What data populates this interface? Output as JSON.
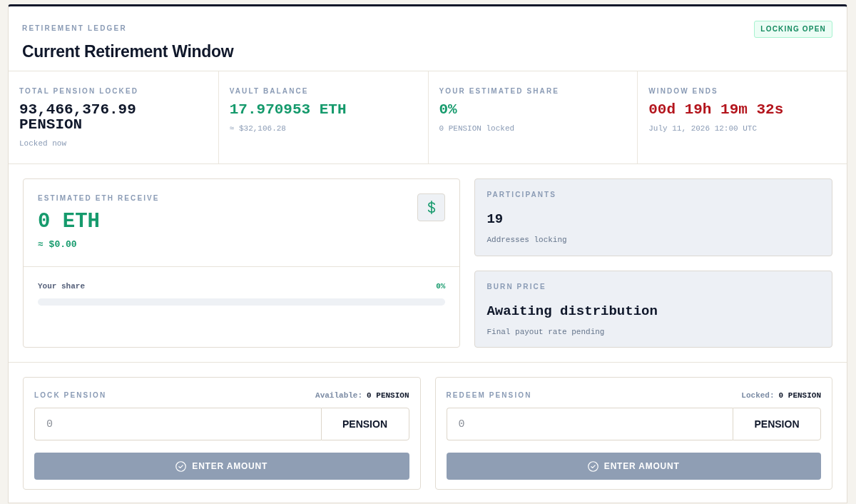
{
  "header": {
    "eyebrow": "RETIREMENT LEDGER",
    "title": "Current Retirement Window",
    "status_badge": "LOCKING OPEN"
  },
  "stats": [
    {
      "label": "TOTAL PENSION LOCKED",
      "value": "93,466,376.99 PENSION",
      "color": "#0f172a",
      "sub": "Locked now"
    },
    {
      "label": "VAULT BALANCE",
      "value": "17.970953 ETH",
      "color": "#159a6c",
      "sub": "≈ $32,106.28"
    },
    {
      "label": "YOUR ESTIMATED SHARE",
      "value": "0%",
      "color": "#159a6c",
      "sub": "0 PENSION locked"
    },
    {
      "label": "WINDOW ENDS",
      "value": "00d 19h 19m 32s",
      "color": "#b3141c",
      "sub": "July 11, 2026 12:00 UTC"
    }
  ],
  "estimate": {
    "label": "ESTIMATED ETH RECEIVE",
    "value": "0 ETH",
    "usd": "≈ $0.00",
    "share_label": "Your share",
    "share_value": "0%",
    "level": 0
  },
  "info_cards": [
    {
      "label": "PARTICIPANTS",
      "value": "19",
      "sub": "Addresses locking"
    },
    {
      "label": "BURN PRICE",
      "value": "Awaiting distribution",
      "sub": "Final payout rate pending"
    }
  ],
  "actions": [
    {
      "title": "LOCK PENSION",
      "balance_label": "Available:",
      "balance_value": "0 PENSION",
      "placeholder": "0",
      "unit": "PENSION",
      "button": "ENTER AMOUNT",
      "disabled": true
    },
    {
      "title": "REDEEM PENSION",
      "balance_label": "Locked:",
      "balance_value": "0 PENSION",
      "placeholder": "0",
      "unit": "PENSION",
      "button": "ENTER AMOUNT",
      "disabled": true
    }
  ]
}
